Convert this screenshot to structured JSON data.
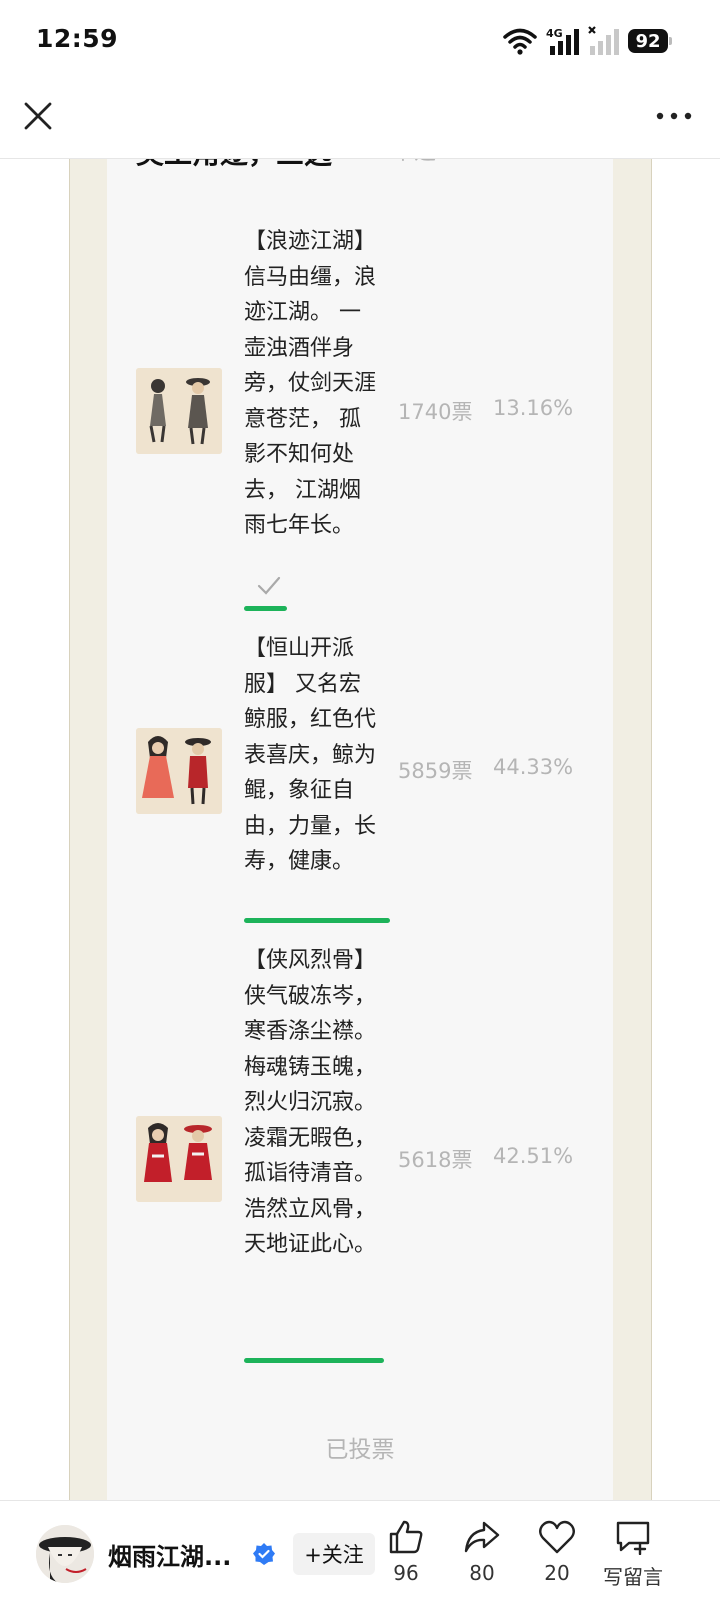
{
  "status_bar": {
    "time": "12:59",
    "network": "4G",
    "battery": "92"
  },
  "nav": {
    "close_icon": "close-icon",
    "more_icon": "more-icon"
  },
  "poll": {
    "title": "美工角逐，三选一",
    "type": "单选",
    "accent_color": "#1db35a",
    "options": [
      {
        "text": "【浪迹江湖】 信马由缰，浪迹江湖。 一壶浊酒伴身旁，仗剑天涯意苍茫， 孤影不知何处去， 江湖烟雨七年长。",
        "votes": "1740票",
        "percent": "13.16%",
        "share": 0.1316,
        "selected": true
      },
      {
        "text": "【恒山开派服】 又名宏鲸服，红色代表喜庆，鲸为鲲，象征自由，力量，长寿，健康。",
        "votes": "5859票",
        "percent": "44.33%",
        "share": 0.4433,
        "selected": false
      },
      {
        "text": "【侠风烈骨】 侠气破冻岑，寒香涤尘襟。 梅魂铸玉魄，烈火归沉寂。 凌霜无暇色，孤诣待清音。 浩然立风骨，天地证此心。",
        "votes": "5618票",
        "percent": "42.51%",
        "share": 0.4251,
        "selected": false
      }
    ],
    "voted_label": "已投票"
  },
  "bottom_bar": {
    "author": "烟雨江湖...",
    "follow_label": "+关注",
    "like_count": "96",
    "share_count": "80",
    "favorite_count": "20",
    "comment_label": "写留言"
  }
}
